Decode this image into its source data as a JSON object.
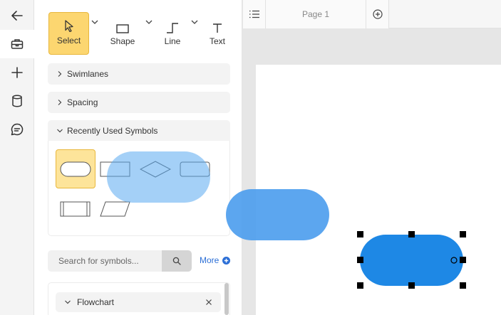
{
  "toolbar": {
    "select_label": "Select",
    "shape_label": "Shape",
    "line_label": "Line",
    "text_label": "Text"
  },
  "sections": {
    "swimlanes": "Swimlanes",
    "spacing": "Spacing",
    "recently_used": "Recently Used Symbols"
  },
  "search": {
    "placeholder": "Search for symbols...",
    "more_label": "More"
  },
  "library": {
    "flowchart": "Flowchart"
  },
  "tabs": {
    "page_label": "Page 1"
  },
  "colors": {
    "accent": "#fcd670",
    "shape_blue": "#1e88e5",
    "drag_ghost": "#5aa9f0",
    "link_blue": "#2c6fd6"
  },
  "icons": {
    "rail": [
      "back-arrow-icon",
      "toolbox-icon",
      "plus-icon",
      "database-icon",
      "comment-icon"
    ],
    "tabs": [
      "list-icon",
      "add-page-icon"
    ]
  }
}
